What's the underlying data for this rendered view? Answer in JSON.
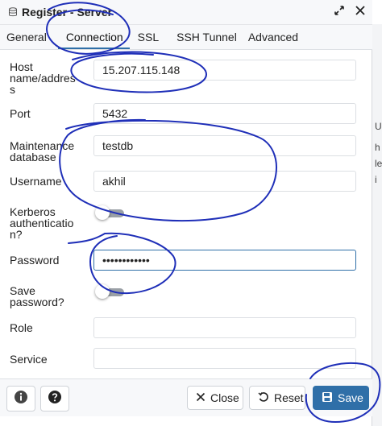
{
  "window": {
    "title": "Register - Server"
  },
  "tabs": [
    {
      "label": "General"
    },
    {
      "label": "Connection"
    },
    {
      "label": "SSL"
    },
    {
      "label": "SSH Tunnel"
    },
    {
      "label": "Advanced"
    }
  ],
  "active_tab": "Connection",
  "form": {
    "host": {
      "label_lines": [
        "Host",
        "name/addres",
        "s"
      ],
      "value": "15.207.115.148"
    },
    "port": {
      "label": "Port",
      "value": "5432"
    },
    "maintenance_db": {
      "label_lines": [
        "Maintenance",
        "database"
      ],
      "value": "testdb"
    },
    "username": {
      "label": "Username",
      "value": "akhil"
    },
    "kerberos": {
      "label_lines": [
        "Kerberos",
        "authenticatio",
        "n?"
      ],
      "enabled": false
    },
    "password": {
      "label": "Password",
      "value": "••••••••••••"
    },
    "save_password": {
      "label_lines": [
        "Save",
        "password?"
      ],
      "enabled": false
    },
    "role": {
      "label": "Role",
      "value": ""
    },
    "service": {
      "label": "Service",
      "value": ""
    }
  },
  "footer": {
    "close_label": "Close",
    "reset_label": "Reset",
    "save_label": "Save"
  },
  "background_partial_text": [
    "U",
    "h",
    "le",
    "i"
  ],
  "colors": {
    "primary": "#2f6fa8",
    "annotation": "#1f2fb8"
  },
  "icons": [
    "database-icon",
    "maximize-icon",
    "close-icon",
    "info-icon",
    "help-icon",
    "reset-icon",
    "save-icon"
  ]
}
